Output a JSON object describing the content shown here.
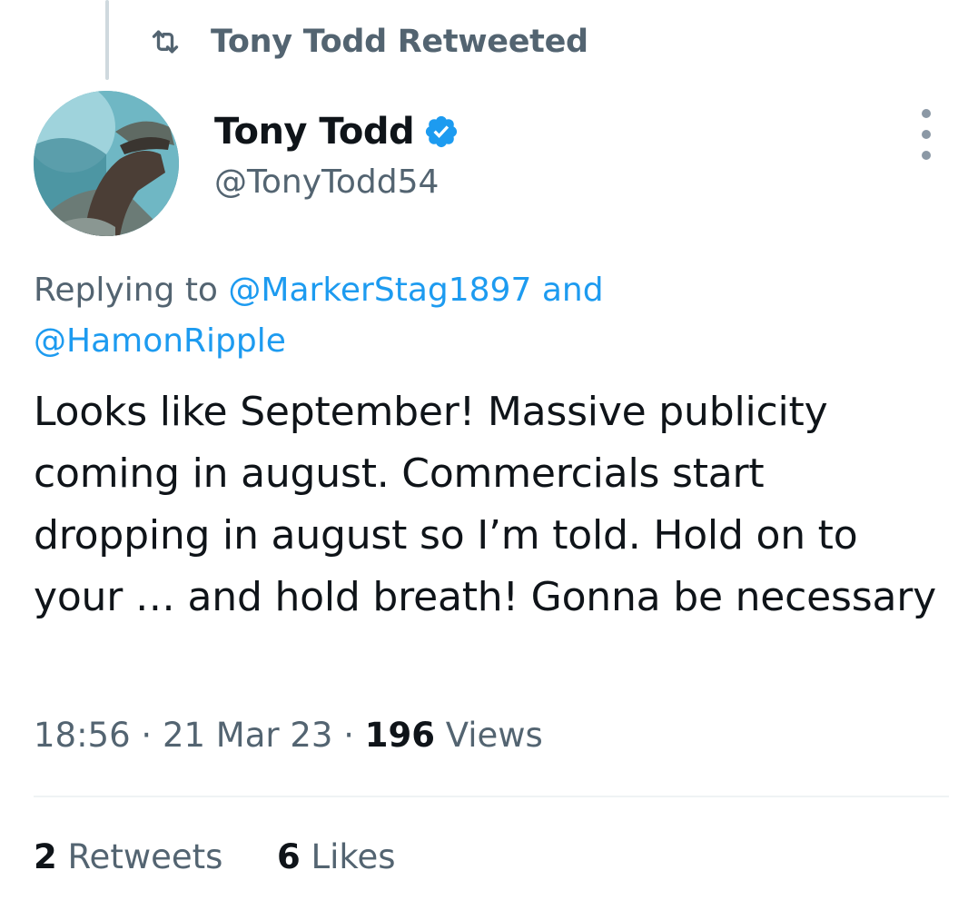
{
  "social_context": {
    "icon": "retweet-icon",
    "label": "Tony Todd Retweeted"
  },
  "author": {
    "display_name": "Tony Todd",
    "handle": "@TonyTodd54",
    "verified": true,
    "avatar": "profile-photo"
  },
  "reply": {
    "prefix": "Replying to",
    "mention_1": "@MarkerStag1897",
    "conjunction": "and",
    "mention_2": "@HamonRipple"
  },
  "tweet": {
    "text": "Looks like September! Massive publicity coming in august. Commercials start dropping in august so I’m told. Hold on to your … and hold breath! Gonna be necessary"
  },
  "meta": {
    "time": "18:56",
    "separator": "·",
    "date": "21 Mar 23",
    "views_count": "196",
    "views_label": "Views"
  },
  "stats": {
    "retweets_count": "2",
    "retweets_label": "Retweets",
    "likes_count": "6",
    "likes_label": "Likes"
  },
  "colors": {
    "accent": "#1d9bf0",
    "secondary_text": "#536471",
    "primary_text": "#0f1419"
  }
}
